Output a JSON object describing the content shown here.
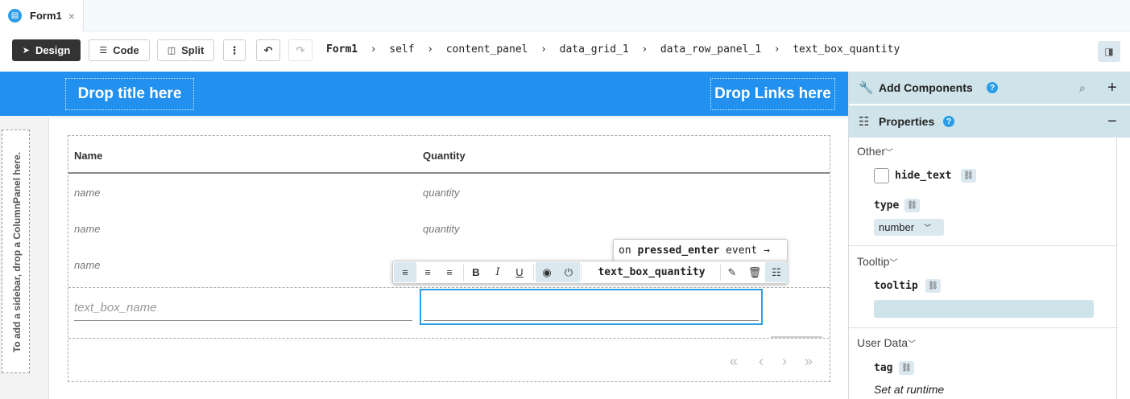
{
  "tab": {
    "title": "Form1",
    "close": "×"
  },
  "toolbar": {
    "design_label": "Design",
    "code_label": "Code",
    "split_label": "Split",
    "more_icon": "⋮",
    "undo_icon": "↶",
    "redo_icon": "↷",
    "breadcrumb": [
      "Form1",
      "self",
      "content_panel",
      "data_grid_1",
      "data_row_panel_1",
      "text_box_quantity"
    ]
  },
  "header": {
    "title_drop": "Drop title here",
    "links_drop": "Drop Links here"
  },
  "sidebar": {
    "hint": "To add a sidebar, drop a ColumnPanel here."
  },
  "grid": {
    "columns": [
      "Name",
      "Quantity"
    ],
    "rows": [
      [
        "name",
        "quantity"
      ],
      [
        "name",
        "quantity"
      ],
      [
        "name",
        ""
      ]
    ],
    "textbox_name_placeholder": "text_box_name",
    "pager": [
      "«",
      "‹",
      "›",
      "»"
    ]
  },
  "event_tooltip": {
    "prefix": "on ",
    "event": "pressed_enter",
    "suffix": " event →"
  },
  "floating_toolbar": {
    "component_name": "text_box_quantity"
  },
  "right_panel": {
    "add_components": "Add Components",
    "properties": "Properties",
    "help_mark": "?",
    "sections": [
      {
        "title": "Other",
        "props": [
          {
            "name": "hide_text"
          },
          {
            "name": "type",
            "value": "number"
          }
        ]
      },
      {
        "title": "Tooltip",
        "props": [
          {
            "name": "tooltip",
            "value": ""
          }
        ]
      },
      {
        "title": "User Data",
        "props": [
          {
            "name": "tag",
            "value": "Set at runtime"
          }
        ]
      }
    ]
  },
  "colors": {
    "accent": "#2290ef",
    "panel_header": "#cfe3ea",
    "selection": "#2a9ee9"
  }
}
